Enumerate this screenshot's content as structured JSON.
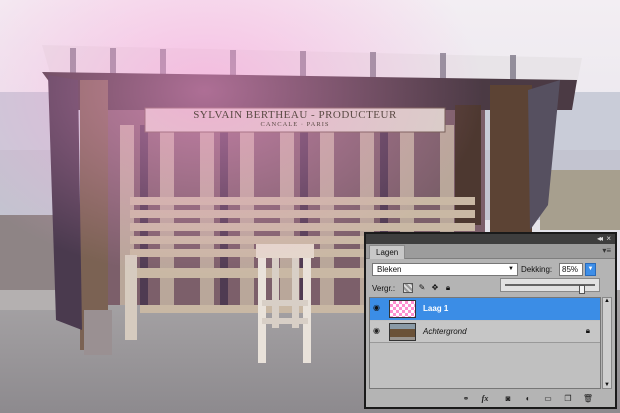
{
  "sign": {
    "line1": "SYLVAIN BERTHEAU - PRODUCTEUR",
    "line2": "CANCALE · PARIS"
  },
  "layers_panel": {
    "tab_label": "Lagen",
    "collapse_icon": "double-chevron-icon",
    "close_icon": "close-icon",
    "menu_icon": "panel-menu-icon",
    "blend_mode": "Bleken",
    "opacity_label": "Dekking:",
    "opacity_value": "85%",
    "opacity_fraction": 0.85,
    "lock_label": "Vergr.:",
    "layers": [
      {
        "name": "Laag 1",
        "selected": true,
        "visible": true
      },
      {
        "name": "Achtergrond",
        "selected": false,
        "visible": true,
        "locked": true
      }
    ],
    "bottom_icons": [
      "link-icon",
      "fx-icon",
      "mask-icon",
      "adjustment-icon",
      "folder-icon",
      "new-layer-icon",
      "trash-icon"
    ]
  },
  "colors": {
    "selection": "#3b8de6",
    "panel_bg": "#b4b4b4",
    "topbar": "#3e3e3e"
  }
}
